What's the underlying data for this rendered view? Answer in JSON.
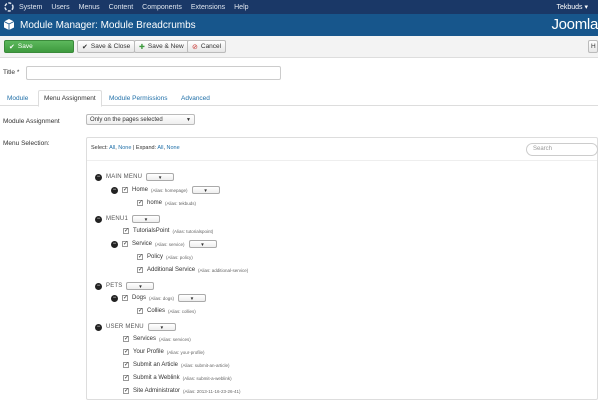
{
  "topbar": {
    "menu": [
      "System",
      "Users",
      "Menus",
      "Content",
      "Components",
      "Extensions",
      "Help"
    ],
    "user": "Tekbuds"
  },
  "header": {
    "title": "Module Manager: Module Breadcrumbs",
    "brand": "Joomla"
  },
  "toolbar": {
    "save": "Save",
    "save_close": "Save & Close",
    "save_new": "Save & New",
    "cancel": "Cancel",
    "help": "H"
  },
  "form": {
    "title_label": "Title *",
    "title_value": ""
  },
  "tabs": [
    "Module",
    "Menu Assignment",
    "Module Permissions",
    "Advanced"
  ],
  "assignment": {
    "label": "Module Assignment",
    "value": "Only on the pages selected"
  },
  "selection": {
    "label": "Menu Selection:",
    "select_text": "Select:",
    "all": "All",
    "none": "None",
    "expand_text": "Expand:",
    "search_placeholder": "Search"
  },
  "tree": [
    {
      "kind": "group",
      "name": "MAIN MENU"
    },
    {
      "kind": "item",
      "name": "Home",
      "alias": "(Alias: homepage)",
      "select": true
    },
    {
      "kind": "item",
      "name": "home",
      "alias": "(Alias: tekbuds)"
    },
    {
      "kind": "group",
      "name": "MENU1"
    },
    {
      "kind": "item",
      "name": "TutorialsPoint",
      "alias": "(Alias: tutorialspoint)"
    },
    {
      "kind": "item",
      "name": "Service",
      "alias": "(Alias: service)",
      "select": true
    },
    {
      "kind": "item",
      "name": "Policy",
      "alias": "(Alias: policy)"
    },
    {
      "kind": "item",
      "name": "Additional Service",
      "alias": "(Alias: additional-service)"
    },
    {
      "kind": "group",
      "name": "PETS"
    },
    {
      "kind": "item",
      "name": "Dogs",
      "alias": "(Alias: dogs)",
      "select": true
    },
    {
      "kind": "item",
      "name": "Collies",
      "alias": "(Alias: collies)"
    },
    {
      "kind": "group",
      "name": "USER MENU"
    },
    {
      "kind": "item",
      "name": "Services",
      "alias": "(Alias: services)"
    },
    {
      "kind": "item",
      "name": "Your Profile",
      "alias": "(Alias: your-profile)"
    },
    {
      "kind": "item",
      "name": "Submit an Article",
      "alias": "(Alias: submit-an-article)"
    },
    {
      "kind": "item",
      "name": "Submit a Weblink",
      "alias": "(Alias: submit-a-weblink)"
    },
    {
      "kind": "item",
      "name": "Site Administrator",
      "alias": "(Alias: 2013-11-16-23-26-41)"
    }
  ]
}
